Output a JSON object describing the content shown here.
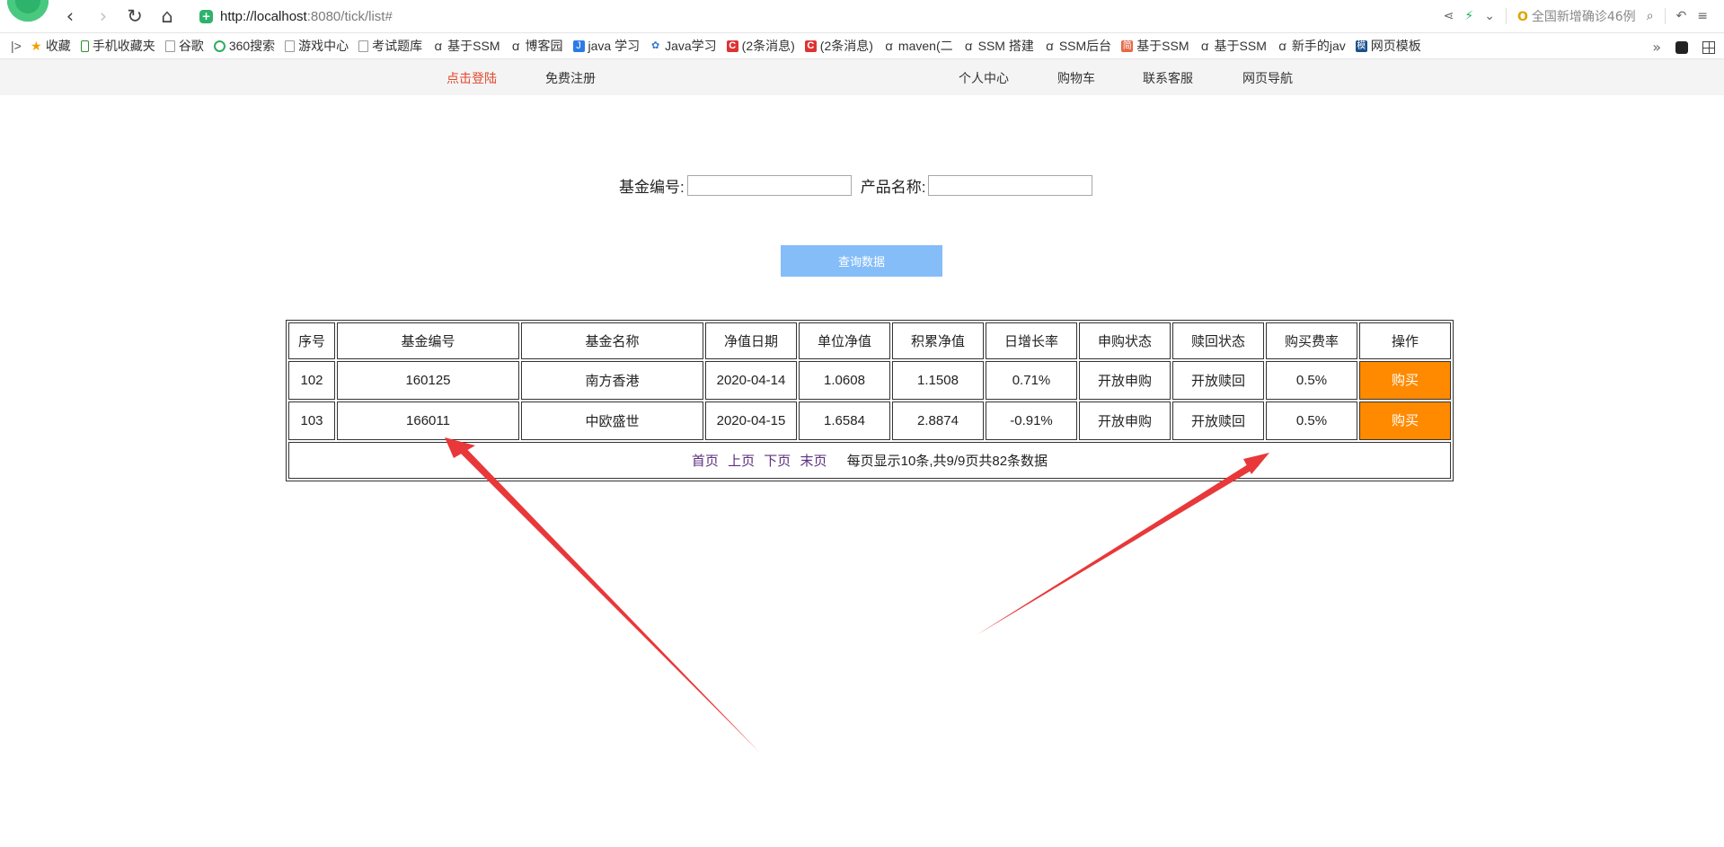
{
  "browser": {
    "url_host": "http://localhost",
    "url_path": ":8080/tick/list#",
    "news_text": "全国新增确诊46例",
    "bookmarks": [
      {
        "label": "收藏",
        "icon": "star-icon"
      },
      {
        "label": "手机收藏夹",
        "icon": "phone-icon"
      },
      {
        "label": "谷歌",
        "icon": "page-icon"
      },
      {
        "label": "360搜索",
        "icon": "circle-icon"
      },
      {
        "label": "游戏中心",
        "icon": "page-icon"
      },
      {
        "label": "考试题库",
        "icon": "page-icon"
      },
      {
        "label": "基于SSM",
        "icon": "a-icon"
      },
      {
        "label": "博客园",
        "icon": "a-icon"
      },
      {
        "label": "java 学习",
        "icon": "j-icon"
      },
      {
        "label": "Java学习",
        "icon": "paw-icon"
      },
      {
        "label": "(2条消息)",
        "icon": "c-icon"
      },
      {
        "label": "(2条消息)",
        "icon": "c-icon"
      },
      {
        "label": "maven(二",
        "icon": "a-icon"
      },
      {
        "label": "SSM 搭建",
        "icon": "a-icon"
      },
      {
        "label": "SSM后台",
        "icon": "a-icon"
      },
      {
        "label": "基于SSM",
        "icon": "jian-icon"
      },
      {
        "label": "基于SSM",
        "icon": "a-icon"
      },
      {
        "label": "新手的jav",
        "icon": "a-icon"
      },
      {
        "label": "网页模板",
        "icon": "mo-icon"
      }
    ]
  },
  "sitenav": {
    "login": "点击登陆",
    "register": "免费注册",
    "personal": "个人中心",
    "cart": "购物车",
    "support": "联系客服",
    "sitemap": "网页导航"
  },
  "search": {
    "fund_code_label": "基金编号:",
    "fund_code_value": "",
    "product_name_label": "产品名称:",
    "product_name_value": "",
    "query_button": "查询数据"
  },
  "table": {
    "headers": [
      "序号",
      "基金编号",
      "基金名称",
      "净值日期",
      "单位净值",
      "积累净值",
      "日增长率",
      "申购状态",
      "赎回状态",
      "购买费率",
      "操作"
    ],
    "rows": [
      [
        "102",
        "160125",
        "南方香港",
        "2020-04-14",
        "1.0608",
        "1.1508",
        "0.71%",
        "开放申购",
        "开放赎回",
        "0.5%",
        "购买"
      ],
      [
        "103",
        "166011",
        "中欧盛世",
        "2020-04-15",
        "1.6584",
        "2.8874",
        "-0.91%",
        "开放申购",
        "开放赎回",
        "0.5%",
        "购买"
      ]
    ],
    "pager": {
      "first": "首页",
      "prev": "上页",
      "next": "下页",
      "last": "末页",
      "info": "每页显示10条,共9/9页共82条数据"
    }
  },
  "colors": {
    "buy_button": "#ff8a00",
    "query_button": "#85bdf8",
    "login_link": "#e2472c",
    "annotation_arrow": "#e8383a"
  }
}
